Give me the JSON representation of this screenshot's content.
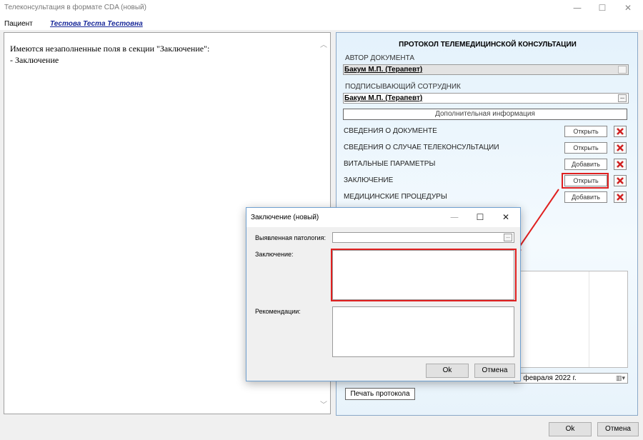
{
  "window": {
    "title": "Телеконсультация в формате CDA (новый)",
    "minimize": "—",
    "maximize": "☐",
    "close": "✕"
  },
  "patient": {
    "label": "Пациент",
    "name": "Тестова Теста Тестовна"
  },
  "left_panel": {
    "message_line1": "Имеются незаполненные поля в секции \"Заключение\":",
    "message_line2": "- Заключение"
  },
  "protocol": {
    "title": "ПРОТОКОЛ ТЕЛЕМЕДИЦИНСКОЙ КОНСУЛЬТАЦИИ",
    "author_label": "АВТОР ДОКУМЕНТА",
    "author_value": "Бакум М.П. (Терапевт)",
    "signer_label": "ПОДПИСЫВАЮЩИЙ СОТРУДНИК",
    "signer_value": "Бакум М.П. (Терапевт)",
    "dots": "...",
    "extra_info_button": "Дополнительная информация",
    "sections": [
      {
        "label": "СВЕДЕНИЯ О ДОКУМЕНТЕ",
        "button": "Открыть"
      },
      {
        "label": "СВЕДЕНИЯ О СЛУЧАЕ ТЕЛЕКОНСУЛЬТАЦИИ",
        "button": "Открыть"
      },
      {
        "label": "ВИТАЛЬНЫЕ ПАРАМЕТРЫ",
        "button": "Добавить"
      },
      {
        "label": "ЗАКЛЮЧЕНИЕ",
        "button": "Открыть"
      },
      {
        "label": "МЕДИЦИНСКИЕ ПРОЦЕДУРЫ",
        "button": "Добавить"
      }
    ],
    "date_value": "2 февраля 2022 г.",
    "print_button": "Печать протокола"
  },
  "footer": {
    "ok": "Ok",
    "cancel": "Отмена"
  },
  "dialog": {
    "title": "Заключение (новый)",
    "minimize": "—",
    "maximize": "☐",
    "close": "✕",
    "pathology_label": "Выявленная патология:",
    "conclusion_label": "Заключение:",
    "recommendations_label": "Рекомендации:",
    "dots": "...",
    "ok": "Ok",
    "cancel": "Отмена"
  },
  "colors": {
    "highlight": "#e02020",
    "patient_link": "#1a2a9a",
    "panel_border": "#8aa8c8"
  }
}
